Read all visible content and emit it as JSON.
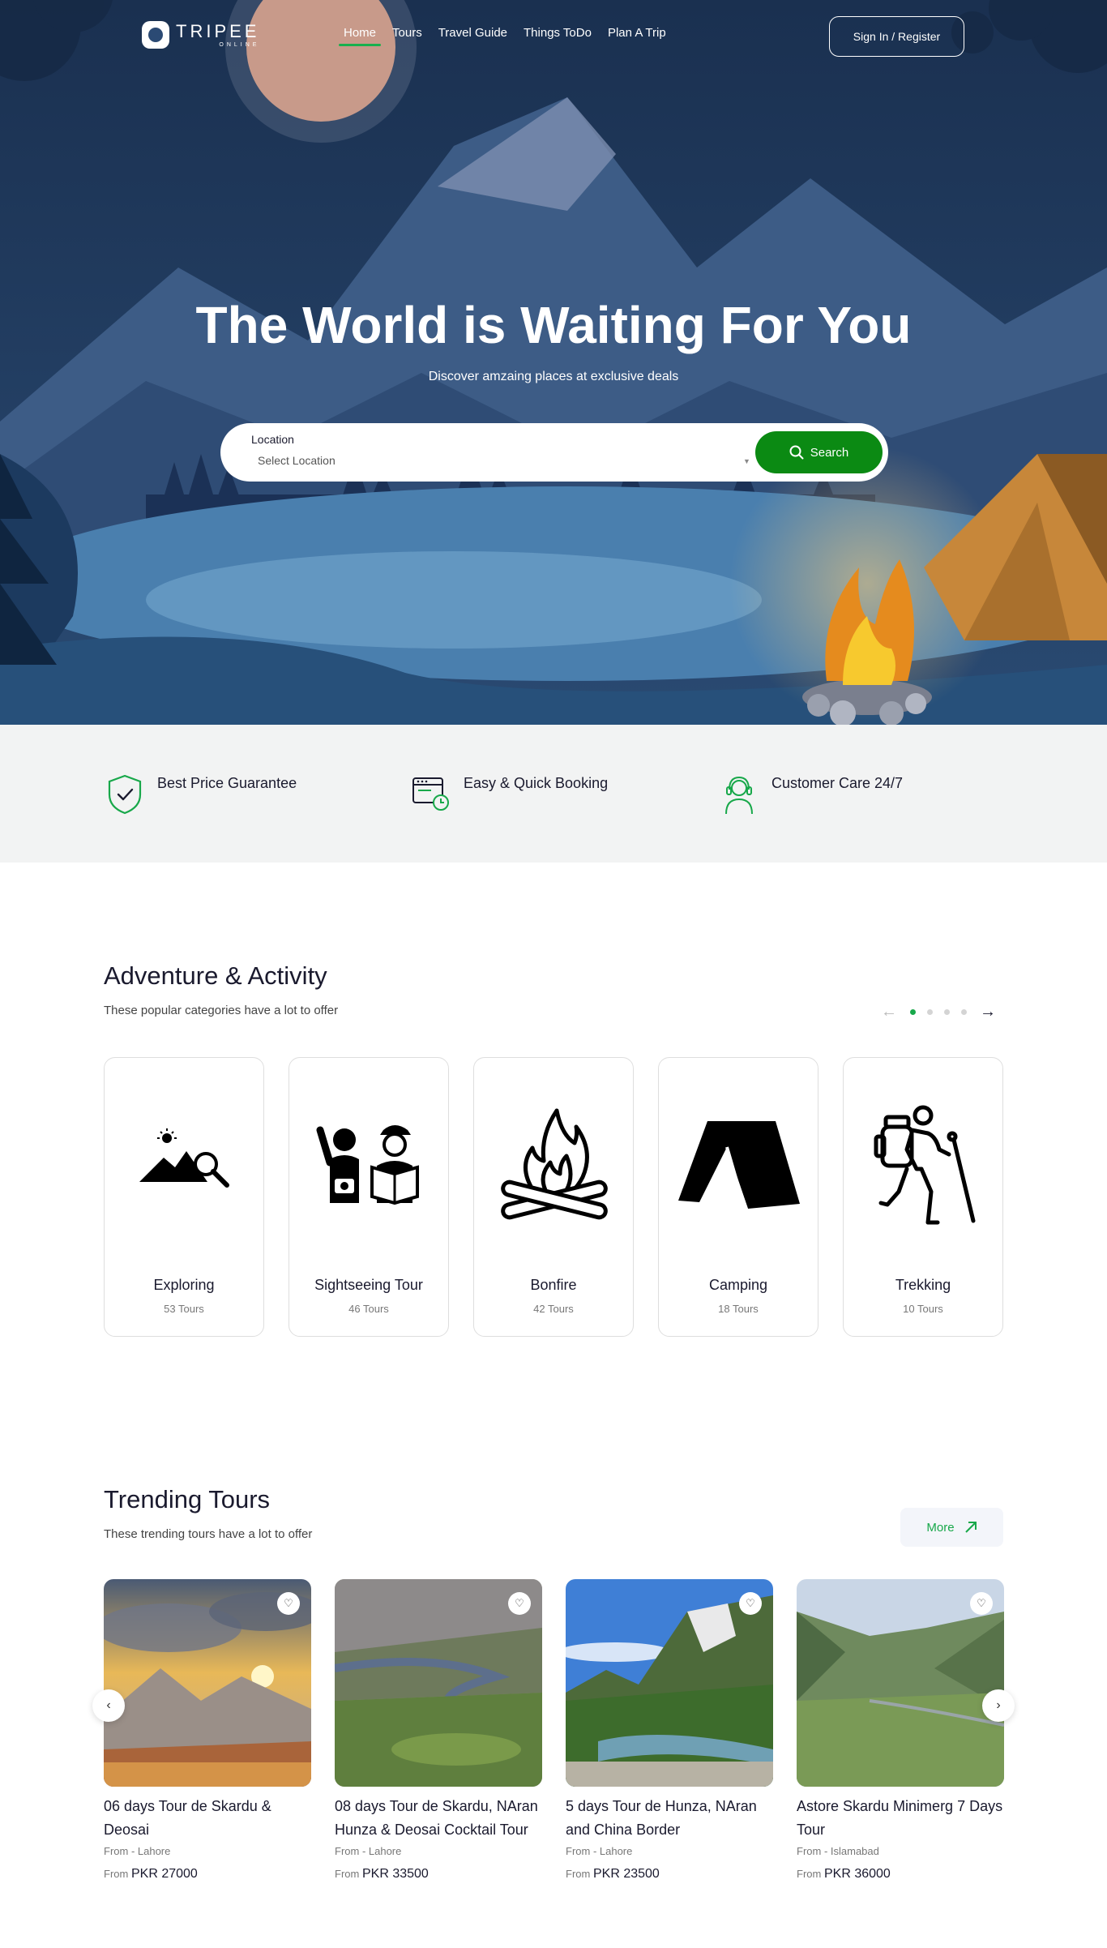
{
  "brand": {
    "name": "TRIPEE",
    "tagline": "ONLINE"
  },
  "nav": {
    "items": [
      {
        "label": "Home",
        "active": true
      },
      {
        "label": "Tours",
        "active": false
      },
      {
        "label": "Travel Guide",
        "active": false
      },
      {
        "label": "Things ToDo",
        "active": false
      },
      {
        "label": "Plan A Trip",
        "active": false
      }
    ],
    "signin_label": "Sign In / Register"
  },
  "hero": {
    "title": "The World is Waiting For You",
    "subtitle": "Discover amzaing places at exclusive deals",
    "search": {
      "location_label": "Location",
      "location_value": "Select Location",
      "button_label": "Search"
    }
  },
  "features": [
    {
      "label": "Best Price Guarantee",
      "icon": "shield-check-icon"
    },
    {
      "label": "Easy & Quick Booking",
      "icon": "calendar-clock-icon"
    },
    {
      "label": "Customer Care 24/7",
      "icon": "headset-agent-icon"
    }
  ],
  "adventure": {
    "title": "Adventure & Activity",
    "subtitle": "These popular categories have a lot to offer",
    "slider_dots": 4,
    "active_dot": 0,
    "categories": [
      {
        "name": "Exploring",
        "count": "53 Tours",
        "icon": "mountain-search-icon"
      },
      {
        "name": "Sightseeing Tour",
        "count": "46 Tours",
        "icon": "tourists-icon"
      },
      {
        "name": "Bonfire",
        "count": "42 Tours",
        "icon": "bonfire-icon"
      },
      {
        "name": "Camping",
        "count": "18 Tours",
        "icon": "tent-icon"
      },
      {
        "name": "Trekking",
        "count": "10 Tours",
        "icon": "hiker-icon"
      }
    ]
  },
  "trending": {
    "title": "Trending Tours",
    "subtitle": "These trending tours have a lot to offer",
    "more_label": "More",
    "tours": [
      {
        "title": "06 days Tour de Skardu & Deosai",
        "from_city": "From - Lahore",
        "price_prefix": "From",
        "price": "PKR 27000"
      },
      {
        "title": "08 days Tour de Skardu, NAran Hunza & Deosai Cocktail Tour",
        "from_city": "From - Lahore",
        "price_prefix": "From",
        "price": "PKR 33500"
      },
      {
        "title": "5 days Tour de Hunza, NAran and China Border",
        "from_city": "From - Lahore",
        "price_prefix": "From",
        "price": "PKR 23500"
      },
      {
        "title": "Astore Skardu Minimerg 7 Days Tour",
        "from_city": "From - Islamabad",
        "price_prefix": "From",
        "price": "PKR 36000"
      }
    ]
  },
  "colors": {
    "accent": "#18a84a",
    "search_button": "#0b8a13",
    "hero_night": "#1c3457"
  }
}
